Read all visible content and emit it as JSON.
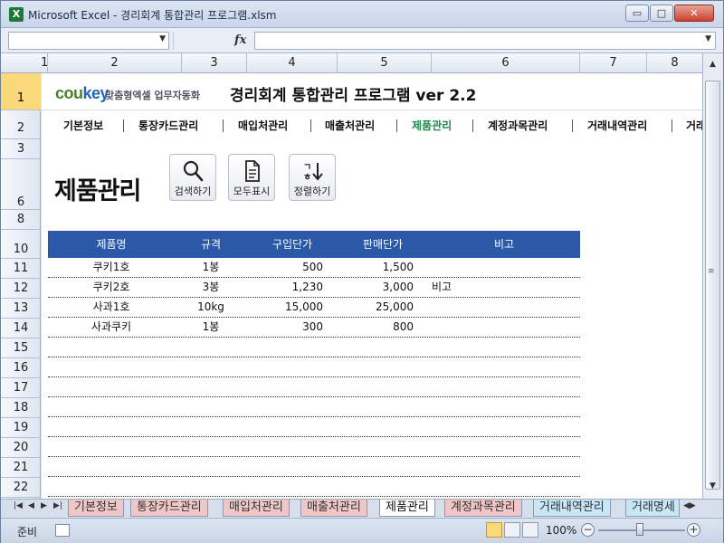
{
  "window": {
    "title": "Microsoft Excel - 경리회계 통합관리 프로그램.xlsm",
    "min_label": "▭",
    "max_label": "□",
    "close_label": "✕"
  },
  "formula_bar": {
    "name_value": "",
    "fx_label": "fx",
    "formula_value": ""
  },
  "columns": [
    "1",
    "2",
    "3",
    "4",
    "5",
    "6",
    "7",
    "8"
  ],
  "rows": [
    "1",
    "2",
    "3",
    "6",
    "8",
    "10",
    "11",
    "12",
    "13",
    "14",
    "15",
    "16",
    "17",
    "18",
    "19",
    "20",
    "21",
    "22"
  ],
  "header": {
    "logo_cou": "cou",
    "logo_key": "key",
    "logo_sub": "맞춤형엑셀 업무자동화",
    "app_title": "경리회계 통합관리 프로그램 ver 2.2"
  },
  "menu": [
    {
      "label": "기본정보",
      "active": false
    },
    {
      "label": "통장카드관리",
      "active": false
    },
    {
      "label": "매입처관리",
      "active": false
    },
    {
      "label": "매출처관리",
      "active": false
    },
    {
      "label": "제품관리",
      "active": true
    },
    {
      "label": "계정과목관리",
      "active": false
    },
    {
      "label": "거래내역관리",
      "active": false
    },
    {
      "label": "거래",
      "active": false
    }
  ],
  "page": {
    "title": "제품관리",
    "search_label": "검색하기",
    "show_all_label": "모두표시",
    "sort_label": "정렬하기"
  },
  "table": {
    "headers": [
      "제품명",
      "규격",
      "구입단가",
      "판매단가",
      "비고"
    ],
    "rows": [
      [
        "쿠키1호",
        "1봉",
        "500",
        "1,500",
        ""
      ],
      [
        "쿠키2호",
        "3봉",
        "1,230",
        "3,000",
        "비고"
      ],
      [
        "사과1호",
        "10kg",
        "15,000",
        "25,000",
        ""
      ],
      [
        "사과쿠키",
        "1봉",
        "300",
        "800",
        ""
      ],
      [
        "",
        "",
        "",
        "",
        ""
      ],
      [
        "",
        "",
        "",
        "",
        ""
      ],
      [
        "",
        "",
        "",
        "",
        ""
      ],
      [
        "",
        "",
        "",
        "",
        ""
      ],
      [
        "",
        "",
        "",
        "",
        ""
      ],
      [
        "",
        "",
        "",
        "",
        ""
      ],
      [
        "",
        "",
        "",
        "",
        ""
      ],
      [
        "",
        "",
        "",
        "",
        ""
      ]
    ]
  },
  "sheet_tabs": [
    {
      "label": "기본정보",
      "active": false,
      "color": "pink"
    },
    {
      "label": "통장카드관리",
      "active": false,
      "color": "pink"
    },
    {
      "label": "매입처관리",
      "active": false,
      "color": "pink"
    },
    {
      "label": "매출처관리",
      "active": false,
      "color": "pink"
    },
    {
      "label": "제품관리",
      "active": true,
      "color": "white"
    },
    {
      "label": "계정과목관리",
      "active": false,
      "color": "pink"
    },
    {
      "label": "거래내역관리",
      "active": false,
      "color": "cyan"
    },
    {
      "label": "거래명세",
      "active": false,
      "color": "cyan"
    }
  ],
  "status": {
    "ready": "준비",
    "zoom": "100%",
    "zoom_out": "−",
    "zoom_in": "+"
  }
}
